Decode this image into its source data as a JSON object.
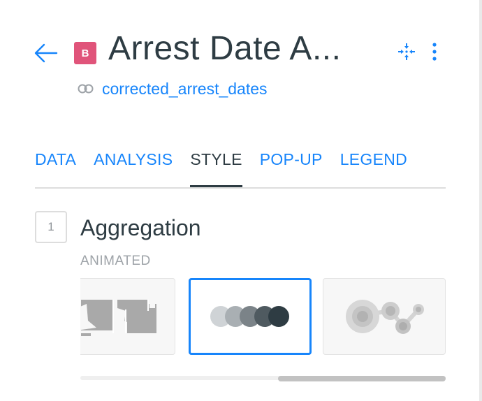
{
  "header": {
    "badge_letter": "B",
    "title": "Arrest Date A...",
    "source_name": "corrected_arrest_dates"
  },
  "tabs": [
    {
      "label": "DATA",
      "active": false
    },
    {
      "label": "ANALYSIS",
      "active": false
    },
    {
      "label": "STYLE",
      "active": true
    },
    {
      "label": "POP-UP",
      "active": false
    },
    {
      "label": "LEGEND",
      "active": false
    }
  ],
  "section": {
    "step_number": "1",
    "title": "Aggregation",
    "subtitle": "ANIMATED"
  },
  "colors": {
    "accent": "#1785FB",
    "badge": "#E0547A",
    "text_dark": "#2E3C43"
  },
  "icons": {
    "back": "arrow-left-icon",
    "collapse": "collapse-arrows-icon",
    "more": "vertical-dots-icon",
    "source": "toggle-link-icon"
  }
}
